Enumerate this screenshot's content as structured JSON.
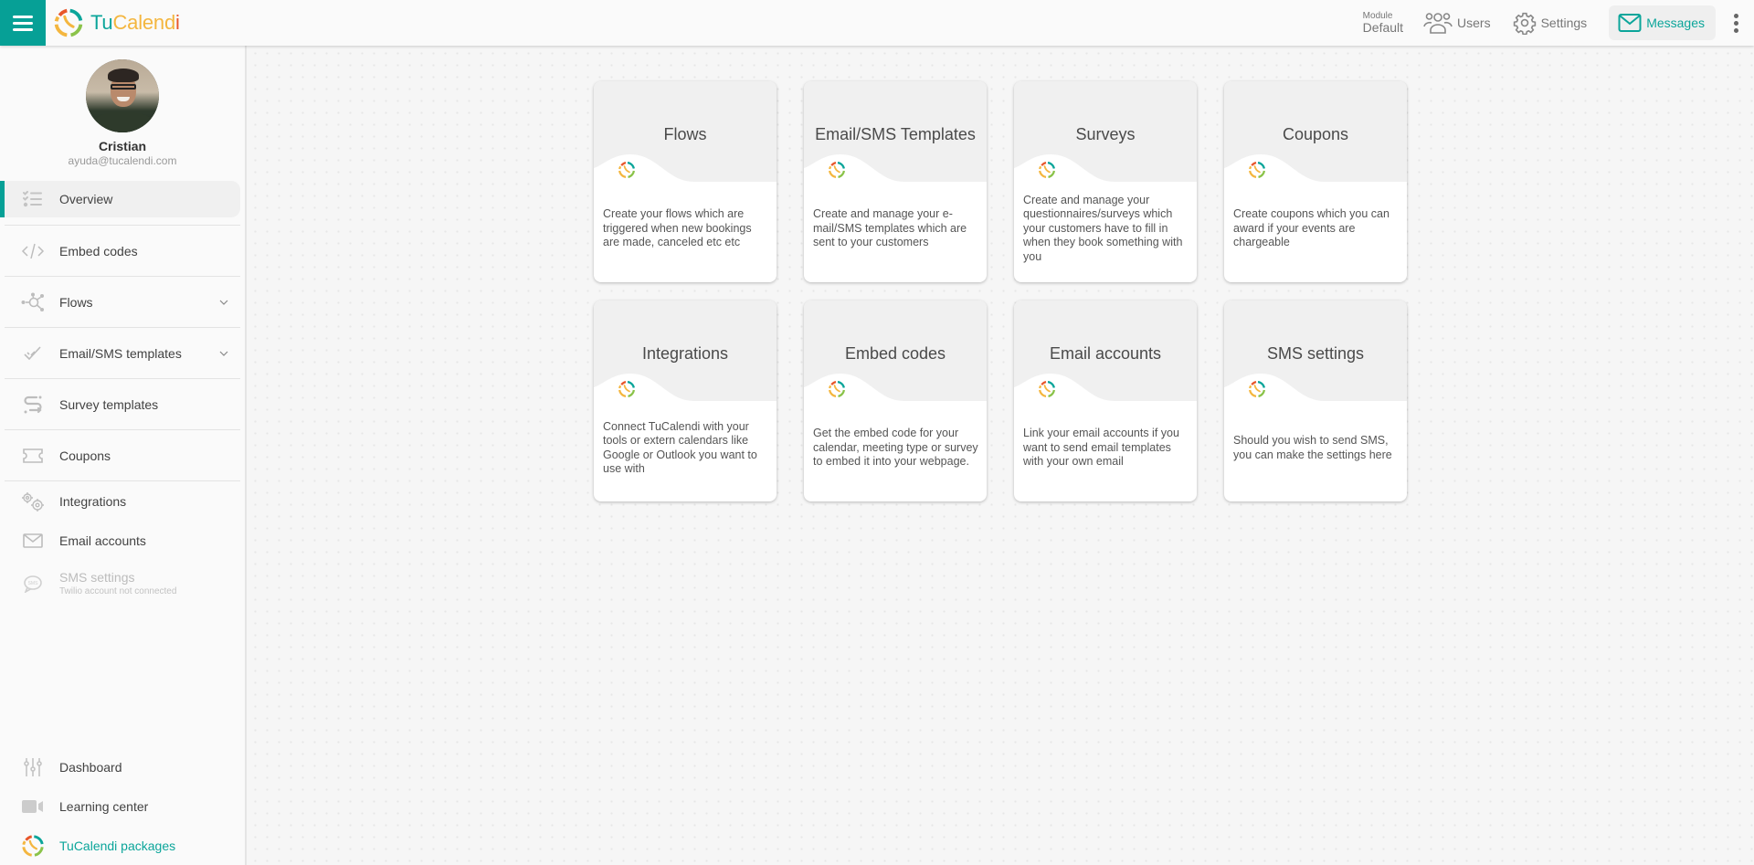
{
  "topbar": {
    "brand": {
      "part1": "Tu",
      "part2": "Calend",
      "part3": "i"
    },
    "module_label": "Module",
    "module_value": "Default",
    "links": [
      {
        "label": "Users",
        "icon": "users-icon"
      },
      {
        "label": "Settings",
        "icon": "gear-icon"
      },
      {
        "label": "Messages",
        "icon": "mail-icon",
        "active": true
      }
    ]
  },
  "colors": {
    "accent": "#06a096",
    "brand_teal": "#0ba59a",
    "brand_yellow": "#f4b63f",
    "brand_red": "#e8562a",
    "brand_green": "#8bc34a"
  },
  "profile": {
    "name": "Cristian",
    "email": "ayuda@tucalendi.com"
  },
  "sidebar": {
    "items": [
      {
        "label": "Overview",
        "icon": "checklist-icon",
        "active": true
      },
      {
        "label": "Embed codes",
        "icon": "code-icon"
      },
      {
        "label": "Flows",
        "icon": "flows-icon",
        "expandable": true
      },
      {
        "label": "Email/SMS templates",
        "icon": "double-check-icon",
        "expandable": true
      },
      {
        "label": "Survey templates",
        "icon": "survey-icon"
      },
      {
        "label": "Coupons",
        "icon": "ticket-icon"
      },
      {
        "label": "Integrations",
        "icon": "gears-icon"
      },
      {
        "label": "Email accounts",
        "icon": "mail-icon"
      },
      {
        "label": "SMS settings",
        "sublabel": "Twilio account not connected",
        "icon": "sms-bubble-icon",
        "disabled": true
      }
    ],
    "bottom": [
      {
        "label": "Dashboard",
        "icon": "sliders-icon"
      },
      {
        "label": "Learning center",
        "icon": "video-camera-icon"
      },
      {
        "label": "TuCalendi packages",
        "icon": "tucalendi-logo-icon"
      }
    ]
  },
  "cards": [
    {
      "title": "Flows",
      "description": "Create your flows which are triggered when new bookings are made, canceled etc etc"
    },
    {
      "title": "Email/SMS Templates",
      "description": "Create and manage your e-mail/SMS templates which are sent to your customers"
    },
    {
      "title": "Surveys",
      "description": "Create and manage your questionnaires/surveys which your customers have to fill in when they book something with you"
    },
    {
      "title": "Coupons",
      "description": "Create coupons which you can award if your events are chargeable"
    },
    {
      "title": "Integrations",
      "description": "Connect TuCalendi with your tools or extern calendars like Google or Outlook you want to use with"
    },
    {
      "title": "Embed codes",
      "description": "Get the embed code for your calendar, meeting type or survey to embed it into your webpage."
    },
    {
      "title": "Email accounts",
      "description": "Link your email accounts if you want to send email templates with your own email"
    },
    {
      "title": "SMS settings",
      "description": "Should you wish to send SMS, you can make the settings here"
    }
  ]
}
